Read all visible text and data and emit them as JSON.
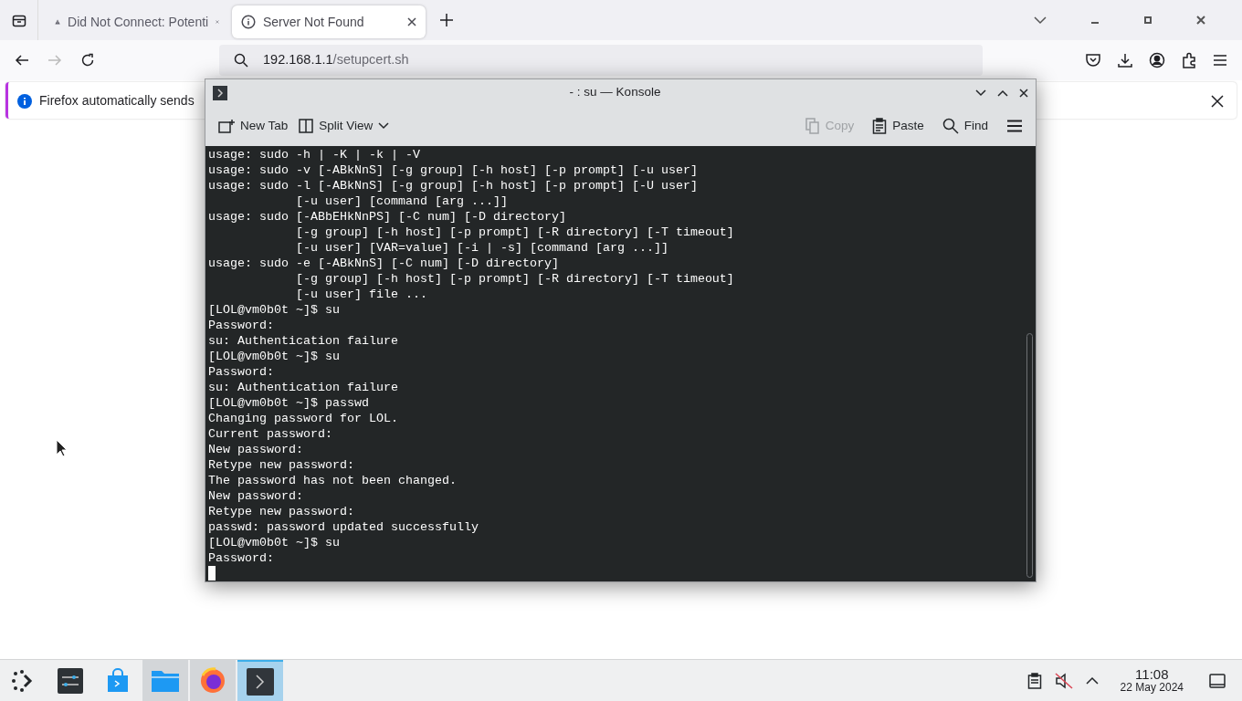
{
  "browser": {
    "tabs": [
      {
        "label": "Did Not Connect: Potenti",
        "kind": "warning",
        "selected": false
      },
      {
        "label": "Server Not Found",
        "kind": "info",
        "selected": true
      }
    ],
    "url": {
      "host": "192.168.1.1",
      "path": "/setupcert.sh"
    },
    "notification": {
      "text": "Firefox automatically sends"
    }
  },
  "konsole": {
    "title": "- : su — Konsole",
    "toolbar_left": [
      {
        "label": "New Tab",
        "kind": "newtab",
        "disabled": false
      },
      {
        "label": "Split View",
        "kind": "split",
        "disabled": false
      }
    ],
    "toolbar_right": [
      {
        "label": "Copy",
        "kind": "copy",
        "disabled": true
      },
      {
        "label": "Paste",
        "kind": "paste",
        "disabled": false
      },
      {
        "label": "Find",
        "kind": "find",
        "disabled": false
      }
    ],
    "lines": [
      "usage: sudo -h | -K | -k | -V",
      "usage: sudo -v [-ABkNnS] [-g group] [-h host] [-p prompt] [-u user]",
      "usage: sudo -l [-ABkNnS] [-g group] [-h host] [-p prompt] [-U user]",
      "            [-u user] [command [arg ...]]",
      "usage: sudo [-ABbEHkNnPS] [-C num] [-D directory]",
      "            [-g group] [-h host] [-p prompt] [-R directory] [-T timeout]",
      "            [-u user] [VAR=value] [-i | -s] [command [arg ...]]",
      "usage: sudo -e [-ABkNnS] [-C num] [-D directory]",
      "            [-g group] [-h host] [-p prompt] [-R directory] [-T timeout]",
      "            [-u user] file ...",
      "[LOL@vm0b0t ~]$ su",
      "Password:",
      "su: Authentication failure",
      "[LOL@vm0b0t ~]$ su",
      "Password:",
      "su: Authentication failure",
      "[LOL@vm0b0t ~]$ passwd",
      "Changing password for LOL.",
      "Current password:",
      "New password:",
      "Retype new password:",
      "The password has not been changed.",
      "New password:",
      "Retype new password:",
      "passwd: password updated successfully",
      "[LOL@vm0b0t ~]$ su",
      "Password:"
    ]
  },
  "taskbar": {
    "apps": [
      {
        "kind": "settings",
        "open": false,
        "selected": false
      },
      {
        "kind": "store",
        "open": false,
        "selected": false
      },
      {
        "kind": "files",
        "open": true,
        "selected": false
      },
      {
        "kind": "firefox",
        "open": true,
        "selected": false
      },
      {
        "kind": "terminal",
        "open": true,
        "selected": true
      }
    ],
    "time": "11:08",
    "date": "22 May 2024"
  }
}
